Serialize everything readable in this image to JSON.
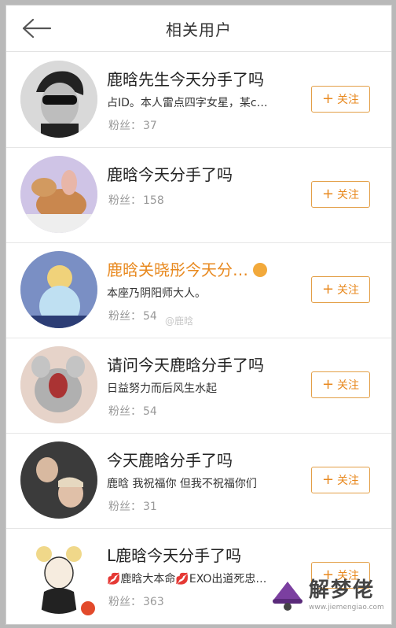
{
  "header": {
    "title": "相关用户"
  },
  "users": [
    {
      "name": "鹿晗先生今天分手了吗",
      "desc": "占ID。本人雷点四字女星，某c…",
      "fans_label": "粉丝：",
      "fans": "37",
      "follow": "关注"
    },
    {
      "name": "鹿晗今天分手了吗",
      "desc": "",
      "fans_label": "粉丝：",
      "fans": "158",
      "follow": "关注"
    },
    {
      "name": "鹿晗关晓彤今天分…",
      "desc": "本座乃阴阳师大人。",
      "fans_label": "粉丝：",
      "fans": "54",
      "follow": "关注"
    },
    {
      "name": "请问今天鹿晗分手了吗",
      "desc": "日益努力而后风生水起",
      "fans_label": "粉丝：",
      "fans": "54",
      "follow": "关注"
    },
    {
      "name": "今天鹿晗分手了吗",
      "desc": "鹿晗 我祝福你 但我不祝福你们",
      "fans_label": "粉丝：",
      "fans": "31",
      "follow": "关注"
    },
    {
      "name": "L鹿晗今天分手了吗",
      "desc": "💋鹿晗大本命💋EXO出道死忠…",
      "fans_label": "粉丝：",
      "fans": "363",
      "follow": "关注"
    }
  ],
  "watermark": "@鹿晗",
  "logo": {
    "text": "解梦佬",
    "url": "www.jiemengiao.com"
  },
  "colors": {
    "accent": "#e8891f",
    "border": "#e39f47"
  },
  "icons": [
    "back-arrow-icon",
    "plus-icon",
    "emoji-icon",
    "weibo-icon"
  ]
}
